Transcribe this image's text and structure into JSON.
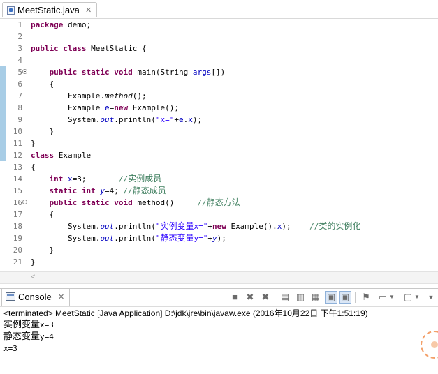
{
  "editor": {
    "tab_label": "MeetStatic.java",
    "tab_icon": "java-file-icon",
    "lines": [
      {
        "num": "1",
        "tokens": [
          {
            "t": "package",
            "c": "kw"
          },
          {
            "t": " demo;"
          }
        ]
      },
      {
        "num": "2",
        "tokens": []
      },
      {
        "num": "3",
        "tokens": [
          {
            "t": "public",
            "c": "kw"
          },
          {
            "t": " "
          },
          {
            "t": "class",
            "c": "kw"
          },
          {
            "t": " MeetStatic {"
          }
        ]
      },
      {
        "num": "4",
        "tokens": []
      },
      {
        "num": "5",
        "fold": true,
        "tokens": [
          {
            "t": "    "
          },
          {
            "t": "public",
            "c": "kw"
          },
          {
            "t": " "
          },
          {
            "t": "static",
            "c": "kw"
          },
          {
            "t": " "
          },
          {
            "t": "void",
            "c": "kw"
          },
          {
            "t": " main(String "
          },
          {
            "t": "args",
            "c": "fld"
          },
          {
            "t": "[])"
          }
        ]
      },
      {
        "num": "6",
        "tokens": [
          {
            "t": "    {"
          }
        ]
      },
      {
        "num": "7",
        "tokens": [
          {
            "t": "        Example."
          },
          {
            "t": "method",
            "c": "it"
          },
          {
            "t": "();"
          }
        ]
      },
      {
        "num": "8",
        "tokens": [
          {
            "t": "        Example "
          },
          {
            "t": "e",
            "c": "fld"
          },
          {
            "t": "="
          },
          {
            "t": "new",
            "c": "kw"
          },
          {
            "t": " Example();"
          }
        ]
      },
      {
        "num": "9",
        "tokens": [
          {
            "t": "        System."
          },
          {
            "t": "out",
            "c": "fld it"
          },
          {
            "t": ".println("
          },
          {
            "t": "\"x=\"",
            "c": "str"
          },
          {
            "t": "+"
          },
          {
            "t": "e",
            "c": "fld"
          },
          {
            "t": "."
          },
          {
            "t": "x",
            "c": "fld"
          },
          {
            "t": ");"
          }
        ]
      },
      {
        "num": "10",
        "tokens": [
          {
            "t": "    }"
          }
        ]
      },
      {
        "num": "11",
        "tokens": [
          {
            "t": "}"
          }
        ]
      },
      {
        "num": "12",
        "tokens": [
          {
            "t": "class",
            "c": "kw"
          },
          {
            "t": " Example"
          }
        ]
      },
      {
        "num": "13",
        "tokens": [
          {
            "t": "{"
          }
        ]
      },
      {
        "num": "14",
        "tokens": [
          {
            "t": "    "
          },
          {
            "t": "int",
            "c": "kw"
          },
          {
            "t": " "
          },
          {
            "t": "x",
            "c": "fld"
          },
          {
            "t": "=3;       "
          },
          {
            "t": "//",
            "c": "cmt"
          },
          {
            "t": "实例成员",
            "c": "cmt cjk"
          }
        ]
      },
      {
        "num": "15",
        "tokens": [
          {
            "t": "    "
          },
          {
            "t": "static",
            "c": "kw"
          },
          {
            "t": " "
          },
          {
            "t": "int",
            "c": "kw"
          },
          {
            "t": " "
          },
          {
            "t": "y",
            "c": "fld it"
          },
          {
            "t": "=4; "
          },
          {
            "t": "//",
            "c": "cmt"
          },
          {
            "t": "静态成员",
            "c": "cmt cjk"
          }
        ]
      },
      {
        "num": "16",
        "fold": true,
        "tokens": [
          {
            "t": "    "
          },
          {
            "t": "public",
            "c": "kw"
          },
          {
            "t": " "
          },
          {
            "t": "static",
            "c": "kw"
          },
          {
            "t": " "
          },
          {
            "t": "void",
            "c": "kw"
          },
          {
            "t": " method()     "
          },
          {
            "t": "//",
            "c": "cmt"
          },
          {
            "t": "静态方法",
            "c": "cmt cjk"
          }
        ]
      },
      {
        "num": "17",
        "tokens": [
          {
            "t": "    {"
          }
        ]
      },
      {
        "num": "18",
        "tokens": [
          {
            "t": "        System."
          },
          {
            "t": "out",
            "c": "fld it"
          },
          {
            "t": ".println("
          },
          {
            "t": "\"",
            "c": "str"
          },
          {
            "t": "实例变量",
            "c": "str cjk"
          },
          {
            "t": "x=\"",
            "c": "str"
          },
          {
            "t": "+"
          },
          {
            "t": "new",
            "c": "kw"
          },
          {
            "t": " Example()."
          },
          {
            "t": "x",
            "c": "fld"
          },
          {
            "t": ");    "
          },
          {
            "t": "//",
            "c": "cmt"
          },
          {
            "t": "类的实例化",
            "c": "cmt cjk"
          }
        ]
      },
      {
        "num": "19",
        "tokens": [
          {
            "t": "        System."
          },
          {
            "t": "out",
            "c": "fld it"
          },
          {
            "t": ".println("
          },
          {
            "t": "\"",
            "c": "str"
          },
          {
            "t": "静态变量",
            "c": "str cjk"
          },
          {
            "t": "y=\"",
            "c": "str"
          },
          {
            "t": "+"
          },
          {
            "t": "y",
            "c": "fld it"
          },
          {
            "t": ");"
          }
        ]
      },
      {
        "num": "20",
        "tokens": [
          {
            "t": "    }"
          }
        ]
      },
      {
        "num": "21",
        "tokens": [
          {
            "t": "}"
          }
        ]
      }
    ]
  },
  "console": {
    "tab_label": "Console",
    "tab_icon": "console-icon",
    "toolbar_icons": [
      "terminate-icon",
      "remove-launch-icon",
      "remove-all-terminated-icon",
      "clear-console-icon",
      "scroll-lock-icon",
      "word-wrap-icon",
      "show-on-stdout-icon",
      "show-on-stderr-icon",
      "pin-console-icon",
      "display-selected-console-icon",
      "open-console-icon",
      "view-menu-icon"
    ],
    "status": "<terminated> MeetStatic [Java Application] D:\\jdk\\jre\\bin\\javaw.exe (2016年10月22日 下午1:51:19)",
    "output": [
      {
        "cjk": "实例变量",
        "rest": "x=3"
      },
      {
        "cjk": "静态变量",
        "rest": "y=4"
      },
      {
        "cjk": "",
        "rest": "x=3"
      }
    ]
  }
}
